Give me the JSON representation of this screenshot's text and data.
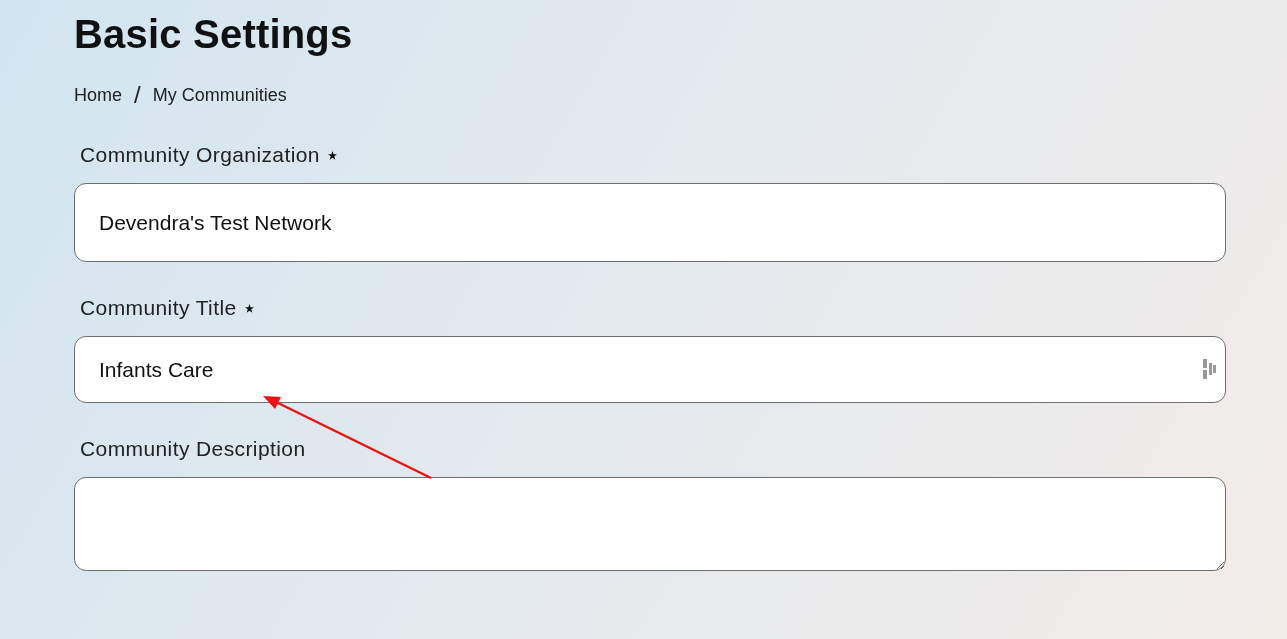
{
  "page": {
    "title": "Basic Settings"
  },
  "breadcrumb": {
    "separator": "/",
    "items": [
      {
        "label": "Home"
      },
      {
        "label": "My Communities"
      }
    ]
  },
  "fields": [
    {
      "label": "Community Organization",
      "required": true,
      "kind": "text",
      "value": "Devendra's Test Network",
      "icon": false
    },
    {
      "label": "Community Title",
      "required": true,
      "kind": "text",
      "value": "Infants Care",
      "icon": true
    },
    {
      "label": "Community Description",
      "required": false,
      "kind": "textarea",
      "icon": false
    }
  ]
}
